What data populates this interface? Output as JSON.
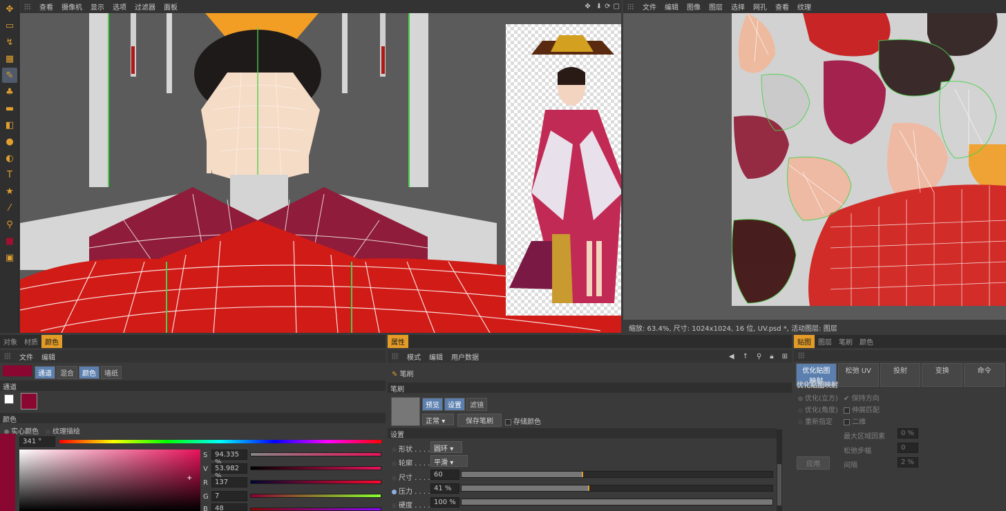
{
  "viewport": {
    "menu": [
      "查看",
      "摄像机",
      "显示",
      "选项",
      "过滤器",
      "面板"
    ],
    "nav_icons": [
      "move-icon",
      "down-arrow-icon",
      "rotate-icon",
      "maximize-icon"
    ]
  },
  "texture": {
    "menu": [
      "文件",
      "编辑",
      "图像",
      "图层",
      "选择",
      "网孔",
      "查看",
      "纹理"
    ],
    "status": "缩放: 63.4%, 尺寸: 1024x1024, 16 位, UV.psd *, 活动图层: 图层"
  },
  "left_panel": {
    "tabs": [
      "对象",
      "材质",
      "颜色"
    ],
    "menu": [
      "文件",
      "编辑"
    ],
    "channel_tabs": [
      "通道",
      "混合",
      "颜色",
      "墙纸"
    ],
    "channel_header": "通道",
    "color_header": "颜色",
    "color_modes": [
      "实心颜色",
      "纹理描绘"
    ],
    "hue_value": "341 °",
    "sliders": [
      {
        "label": "S",
        "value": "94.335 %",
        "fraction": 0.94
      },
      {
        "label": "V",
        "value": "53.982 %",
        "fraction": 0.54
      },
      {
        "label": "R",
        "value": "137",
        "fraction": 0.54
      },
      {
        "label": "G",
        "value": "7",
        "fraction": 0.03
      },
      {
        "label": "B",
        "value": "48",
        "fraction": 0.19
      }
    ],
    "swatch_color": "#890730"
  },
  "attr_panel": {
    "tabs": [
      "属性"
    ],
    "menu": [
      "模式",
      "编辑",
      "用户数据"
    ],
    "brush_label": "笔刷",
    "brush_header": "笔刷",
    "preview_tabs": [
      "预览",
      "设置",
      "滤镜"
    ],
    "mode_value": "正常",
    "save_brush": "保存笔刷",
    "store_color": "存储颜色",
    "settings_header": "设置",
    "rows": [
      {
        "label": "形状 . . . .",
        "value": "圆环",
        "type": "dropdown"
      },
      {
        "label": "轮廓 . . . .",
        "value": "平滑",
        "type": "dropdown"
      },
      {
        "label": "尺寸 . . . .",
        "value": "60",
        "type": "slider",
        "fraction": 0.39
      },
      {
        "label": "压力 . . . .",
        "value": "41 %",
        "type": "slider",
        "fraction": 0.41
      },
      {
        "label": "硬度 . . . .",
        "value": "100 %",
        "type": "slider",
        "fraction": 1.0
      }
    ]
  },
  "uv_panel": {
    "tabs": [
      "贴图",
      "图层",
      "笔刷",
      "颜色"
    ],
    "tool_tabs": [
      "优化贴图映射",
      "松弛 UV",
      "投射",
      "变换",
      "命令"
    ],
    "header": "优化贴图映射",
    "radios": [
      "优化(立方)",
      "优化(角度)",
      "重新指定"
    ],
    "checks": [
      {
        "label": "保持方向",
        "checked": true
      },
      {
        "label": "伸展匹配",
        "checked": false
      },
      {
        "label": "二维",
        "checked": false
      }
    ],
    "fields": [
      {
        "label": "最大区域因素",
        "value": "0 %"
      },
      {
        "label": "松弛步幅",
        "value": "0"
      },
      {
        "label": "间隔",
        "value": "2 %"
      }
    ],
    "apply": "应用"
  }
}
